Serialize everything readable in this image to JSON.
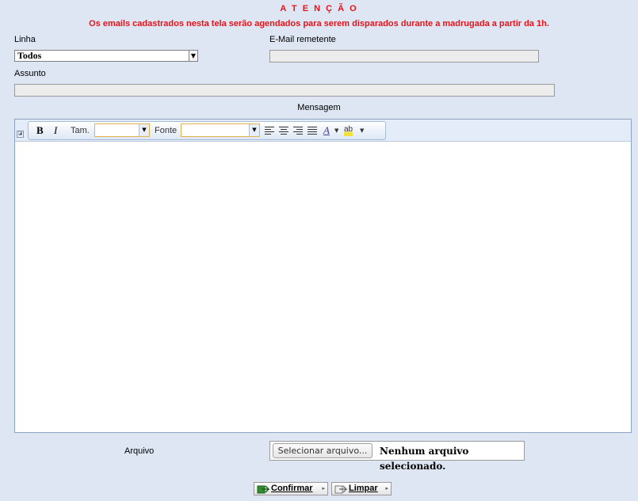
{
  "warning": {
    "title": "A T E N Ç Ã O",
    "message": "Os emails cadastrados nesta tela serão agendados para serem disparados durante a madrugada a partir da 1h."
  },
  "form": {
    "linha_label": "Linha",
    "linha_value": "Todos",
    "email_label": "E-Mail remetente",
    "email_value": "",
    "assunto_label": "Assunto",
    "assunto_value": "",
    "mensagem_label": "Mensagem",
    "arquivo_label": "Arquivo"
  },
  "editor": {
    "bold": "B",
    "italic": "I",
    "size_label": "Tam.",
    "font_label": "Fonte",
    "font_color_glyph": "A",
    "highlight_glyph": "ab"
  },
  "file": {
    "button_label": "Selecionar arquivo...",
    "status": "Nenhum arquivo selecionado."
  },
  "actions": {
    "confirm_label": "Confirmar",
    "clear_label": "Limpar"
  },
  "colors": {
    "background": "#dde6f2",
    "warning": "#e8121b"
  }
}
